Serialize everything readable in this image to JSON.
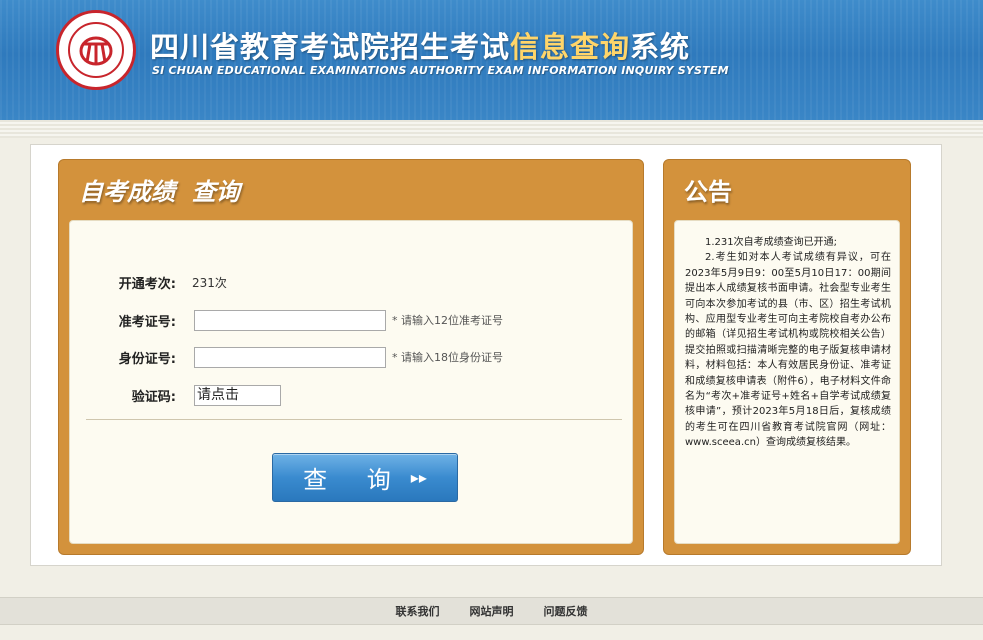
{
  "header": {
    "title_part1": "四川省教育考试院招生考试",
    "title_part2": "信息查询",
    "title_part3": "系统",
    "subtitle_en": "SI CHUAN EDUCATIONAL EXAMINATIONS AUTHORITY EXAM INFORMATION INQUIRY SYSTEM",
    "logo_icon": "sceea-seal-logo"
  },
  "query_panel": {
    "title": "自考成绩  查询",
    "exam_session_label": "开通考次:",
    "exam_session_value": "231次",
    "ticket_label": "准考证号:",
    "ticket_value": "",
    "ticket_hint": "* 请输入12位准考证号",
    "id_label": "身份证号:",
    "id_value": "",
    "id_hint": "* 请输入18位身份证号",
    "captcha_label": "验证码:",
    "captcha_text": "请点击",
    "submit_label": "查 询",
    "submit_icon": "double-chevron-right-icon"
  },
  "notice_panel": {
    "title": "公告",
    "paragraphs": [
      "1.231次自考成绩查询已开通;",
      "2.考生如对本人考试成绩有异议，可在2023年5月9日9：00至5月10日17：00期间提出本人成绩复核书面申请。社会型专业考生可向本次参加考试的县（市、区）招生考试机构、应用型专业考生可向主考院校自考办公布的邮箱（详见招生考试机构或院校相关公告）提交拍照或扫描清晰完整的电子版复核申请材料，材料包括：本人有效居民身份证、准考证和成绩复核申请表（附件6），电子材料文件命名为“考次+准考证号+姓名+自学考试成绩复核申请”，预计2023年5月18日后，复核成绩的考生可在四川省教育考试院官网（网址：www.sceea.cn）查询成绩复核结果。"
    ]
  },
  "footer": {
    "links": [
      "联系我们",
      "网站声明",
      "问题反馈"
    ]
  },
  "colors": {
    "header_blue": "#2f7abd",
    "panel_orange": "#d3923c",
    "button_blue": "#3a8bcf",
    "logo_red": "#c8252c"
  }
}
